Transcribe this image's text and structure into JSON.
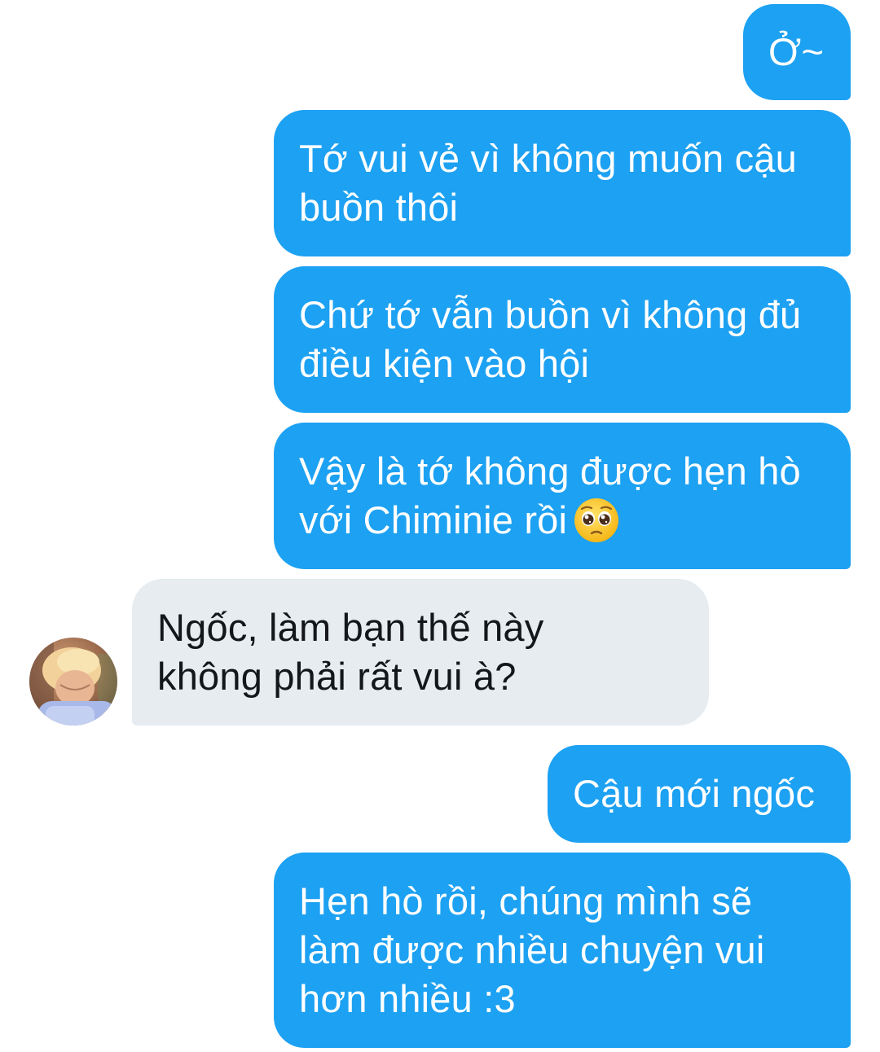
{
  "conversation": {
    "messages": [
      {
        "sender": "me",
        "text": "Ở~"
      },
      {
        "sender": "me",
        "text": "Tớ vui vẻ vì không muốn cậu\nbuồn thôi"
      },
      {
        "sender": "me",
        "text": "Chứ tớ vẫn buồn vì không đủ\nđiều kiện vào hội"
      },
      {
        "sender": "me",
        "text": "Vậy là tớ không được hẹn hò\nvới Chiminie rồi",
        "emoji": "pleading-face-emoji"
      },
      {
        "sender": "contact",
        "text": "Ngốc, làm bạn thế này\nkhông phải rất vui à?"
      },
      {
        "sender": "me",
        "text": "Cậu mới ngốc"
      },
      {
        "sender": "me",
        "text": "Hẹn hò rồi, chúng mình sẽ\nlàm được nhiều chuyện vui\nhơn nhiều :3"
      }
    ]
  },
  "contact": {
    "avatar_icon": "profile-photo-avatar"
  },
  "colors": {
    "sent_bubble": "#1da1f2",
    "received_bubble": "#e6ecf0",
    "sent_text": "#ffffff",
    "received_text": "#14171a"
  }
}
